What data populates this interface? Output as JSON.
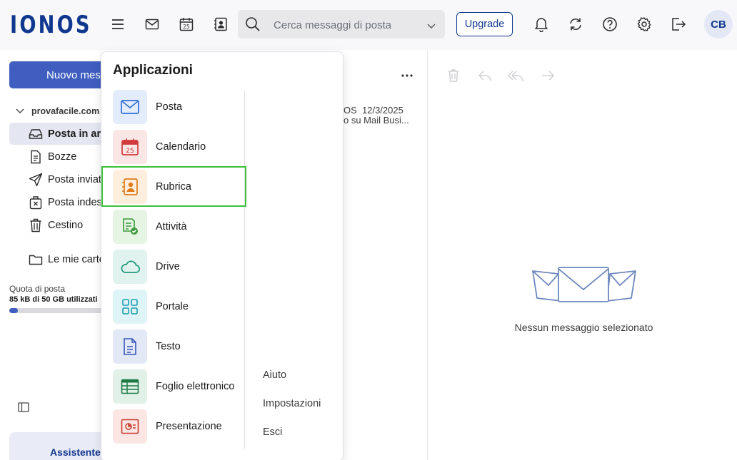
{
  "header": {
    "logo": "IONOS",
    "search_placeholder": "Cerca messaggi di posta",
    "upgrade_label": "Upgrade",
    "avatar_initials": "CB"
  },
  "sidebar": {
    "new_message_label": "Nuovo messaggio",
    "account": "provafacile.com",
    "folders": [
      {
        "label": "Posta in arrivo",
        "icon": "inbox-icon",
        "selected": true
      },
      {
        "label": "Bozze",
        "icon": "draft-icon"
      },
      {
        "label": "Posta inviata",
        "icon": "send-icon"
      },
      {
        "label": "Posta indesiderata",
        "icon": "spam-icon"
      },
      {
        "label": "Cestino",
        "icon": "trash-icon"
      },
      {
        "label": "Le mie cartelle",
        "icon": "folder-icon"
      }
    ],
    "quota_label": "Quota di posta",
    "quota_value": "85 kB di 50 GB utilizzati",
    "quota_fraction": 0.01,
    "assistant_label": "Assistente"
  },
  "message_list": {
    "sender_partial": "OS",
    "date": "12/3/2025",
    "subject_partial": "o su Mail Busi..."
  },
  "reading_pane": {
    "empty_text": "Nessun messaggio selezionato"
  },
  "apps_menu": {
    "title": "Applicazioni",
    "apps": [
      {
        "label": "Posta",
        "icon": "mail-icon",
        "tile_color": "#e3ecfb"
      },
      {
        "label": "Calendario",
        "icon": "calendar-icon",
        "tile_color": "#fbe6e6"
      },
      {
        "label": "Rubrica",
        "icon": "contacts-icon",
        "tile_color": "#fdeedd",
        "highlighted": true
      },
      {
        "label": "Attività",
        "icon": "tasks-icon",
        "tile_color": "#e6f4e4"
      },
      {
        "label": "Drive",
        "icon": "cloud-icon",
        "tile_color": "#e1f3ee"
      },
      {
        "label": "Portale",
        "icon": "grid-icon",
        "tile_color": "#dff4f7"
      },
      {
        "label": "Testo",
        "icon": "document-icon",
        "tile_color": "#e3e8f7"
      },
      {
        "label": "Foglio elettronico",
        "icon": "spreadsheet-icon",
        "tile_color": "#e1f1e8"
      },
      {
        "label": "Presentazione",
        "icon": "presentation-icon",
        "tile_color": "#fbe6e4"
      }
    ],
    "links": [
      "Aiuto",
      "Impostazioni",
      "Esci"
    ]
  },
  "colors": {
    "brand": "#11388f",
    "primary_button": "#3f5ec0",
    "highlight": "#3cc13b"
  }
}
